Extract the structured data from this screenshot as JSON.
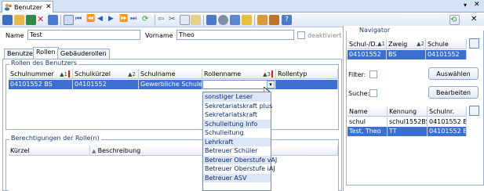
{
  "window_tab": {
    "label": "Benutzer"
  },
  "form": {
    "name_label": "Name",
    "name_value": "Test",
    "vorname_label": "Vorname",
    "vorname_value": "Theo",
    "deaktiviert_label": "deaktiviert"
  },
  "subtabs": [
    "Benutzer",
    "Rollen",
    "Gebäuderollen"
  ],
  "rollen_group": {
    "title": "Rollen des Benutzers",
    "columns": [
      "Schulnummer",
      "Schulkürzel",
      "Schulname",
      "Rollenname",
      "Rollentyp"
    ],
    "sort": [
      "1",
      "2",
      "",
      "3",
      ""
    ],
    "row": [
      "04101552 BS",
      "04101552",
      "Gewerbliche Schule ...",
      "",
      ""
    ]
  },
  "dropdown": {
    "items": [
      "sonstiger Leser",
      "Sekretariatskraft plus",
      "Sekretariatskraft",
      "Schulleitung Info",
      "Schulleitung",
      "Lehrkraft",
      "Betreuer Schüler",
      "Betreuer Oberstufe vAJ",
      "Betreuer Oberstufe iAJ",
      "Betreuer ASV"
    ]
  },
  "berechtigungen_group": {
    "title": "Berechtigungen der Rolle(n)",
    "columns": [
      "Kürzel",
      "Beschreibung"
    ]
  },
  "navigator": {
    "title": "Navigator",
    "top_columns": [
      "Schul-/D...",
      "Zweig",
      "Schule"
    ],
    "top_sort": [
      "1",
      "2",
      ""
    ],
    "top_row": [
      "04101552",
      "BS",
      "04101552"
    ],
    "filter_label": "Filter:",
    "suche_label": "Suche:",
    "auswaehlen_label": "Auswählen",
    "bearbeiten_label": "Bearbeiten",
    "bottom_columns": [
      "Name",
      "Kennung",
      "Schulnr."
    ],
    "bottom_rows": [
      [
        "schul",
        "schul1552BS",
        "04101552 BS"
      ],
      [
        "Test, Theo",
        "TT",
        "04101552 BS"
      ]
    ]
  }
}
